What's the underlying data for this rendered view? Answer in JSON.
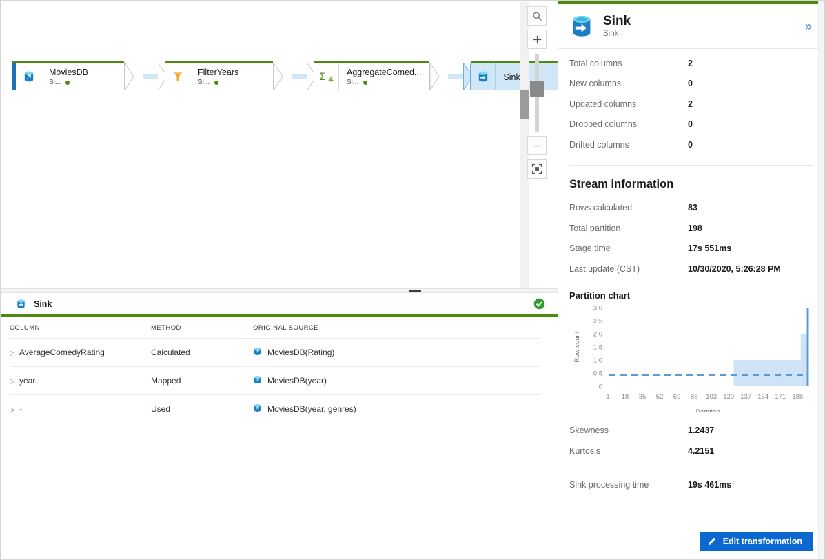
{
  "canvas": {
    "tools": [
      {
        "name": "search-icon",
        "label": "Search"
      },
      {
        "name": "zoom-in-icon",
        "label": "+"
      },
      {
        "name": "zoom-out-icon",
        "label": "–"
      },
      {
        "name": "fit-to-screen-icon",
        "label": "Fit to screen"
      }
    ],
    "nodes": [
      {
        "title": "MoviesDB",
        "subtitle": "Si...",
        "icon": "source-database-icon",
        "status": "ok",
        "selected": false
      },
      {
        "title": "FilterYears",
        "subtitle": "Si...",
        "icon": "filter-icon",
        "status": "ok",
        "selected": false
      },
      {
        "title": "AggregateComed...",
        "subtitle": "Si...",
        "icon": "aggregate-icon",
        "status": "ok",
        "selected": false
      },
      {
        "title": "Sink",
        "subtitle": "",
        "icon": "sink-database-icon",
        "status": "check",
        "selected": true
      }
    ]
  },
  "inspect": {
    "title": "Sink",
    "icon": "sink-database-icon",
    "status_icon": "green-check-icon",
    "columns_header": [
      "COLUMN",
      "METHOD",
      "ORIGINAL SOURCE"
    ],
    "rows": [
      {
        "column": "AverageComedyRating",
        "method": "Calculated",
        "source": "MoviesDB(Rating)"
      },
      {
        "column": "year",
        "method": "Mapped",
        "source": "MoviesDB(year)"
      },
      {
        "column": "-",
        "method": "Used",
        "source": "MoviesDB(year, genres)"
      }
    ]
  },
  "panel": {
    "title": "Sink",
    "subtitle": "Sink",
    "icon": "sink-database-icon",
    "collapse_icon": "double-chevron-right-icon",
    "column_stats": [
      {
        "label": "Total columns",
        "value": "2"
      },
      {
        "label": "New columns",
        "value": "0"
      },
      {
        "label": "Updated columns",
        "value": "2"
      },
      {
        "label": "Dropped columns",
        "value": "0"
      },
      {
        "label": "Drifted columns",
        "value": "0"
      }
    ],
    "stream_section_title": "Stream information",
    "stream_stats": [
      {
        "label": "Rows calculated",
        "value": "83"
      },
      {
        "label": "Total partition",
        "value": "198"
      },
      {
        "label": "Stage time",
        "value": "17s 551ms"
      },
      {
        "label": "Last update (CST)",
        "value": "10/30/2020, 5:26:28 PM"
      }
    ],
    "moment_stats": [
      {
        "label": "Skewness",
        "value": "1.2437"
      },
      {
        "label": "Kurtosis",
        "value": "4.2151"
      }
    ],
    "processing": {
      "label": "Sink processing time",
      "value": "19s 461ms"
    },
    "edit_button": {
      "label": "Edit transformation",
      "icon": "pencil-icon"
    }
  },
  "colors": {
    "accent_green": "#4f8a10",
    "accent_blue": "#0b68d0",
    "bar_fill": "#cfe3f7",
    "mean_line": "#5b9bd5",
    "selected_node": "#cfe7f7"
  },
  "chart_data": {
    "type": "bar",
    "title": "Partition chart",
    "xlabel": "Partition",
    "ylabel": "Row count",
    "xlim": [
      1,
      198
    ],
    "ylim": [
      0,
      3.0
    ],
    "xticks": [
      1,
      18,
      35,
      52,
      69,
      86,
      103,
      120,
      137,
      154,
      171,
      188
    ],
    "yticks": [
      0,
      0.5,
      1.0,
      1.5,
      2.0,
      2.5,
      3.0
    ],
    "grid": false,
    "legend": null,
    "mean_line": {
      "value": 0.42,
      "style": "dashed",
      "color": "#5b9bd5"
    },
    "series": [
      {
        "name": "Row count",
        "bins": [
          {
            "x_start": 1,
            "x_end": 124,
            "value": 0
          },
          {
            "x_start": 125,
            "x_end": 190,
            "value": 1.0
          },
          {
            "x_start": 191,
            "x_end": 196,
            "value": 2.0
          },
          {
            "x_start": 197,
            "x_end": 198,
            "value": 3.0
          }
        ]
      }
    ]
  }
}
